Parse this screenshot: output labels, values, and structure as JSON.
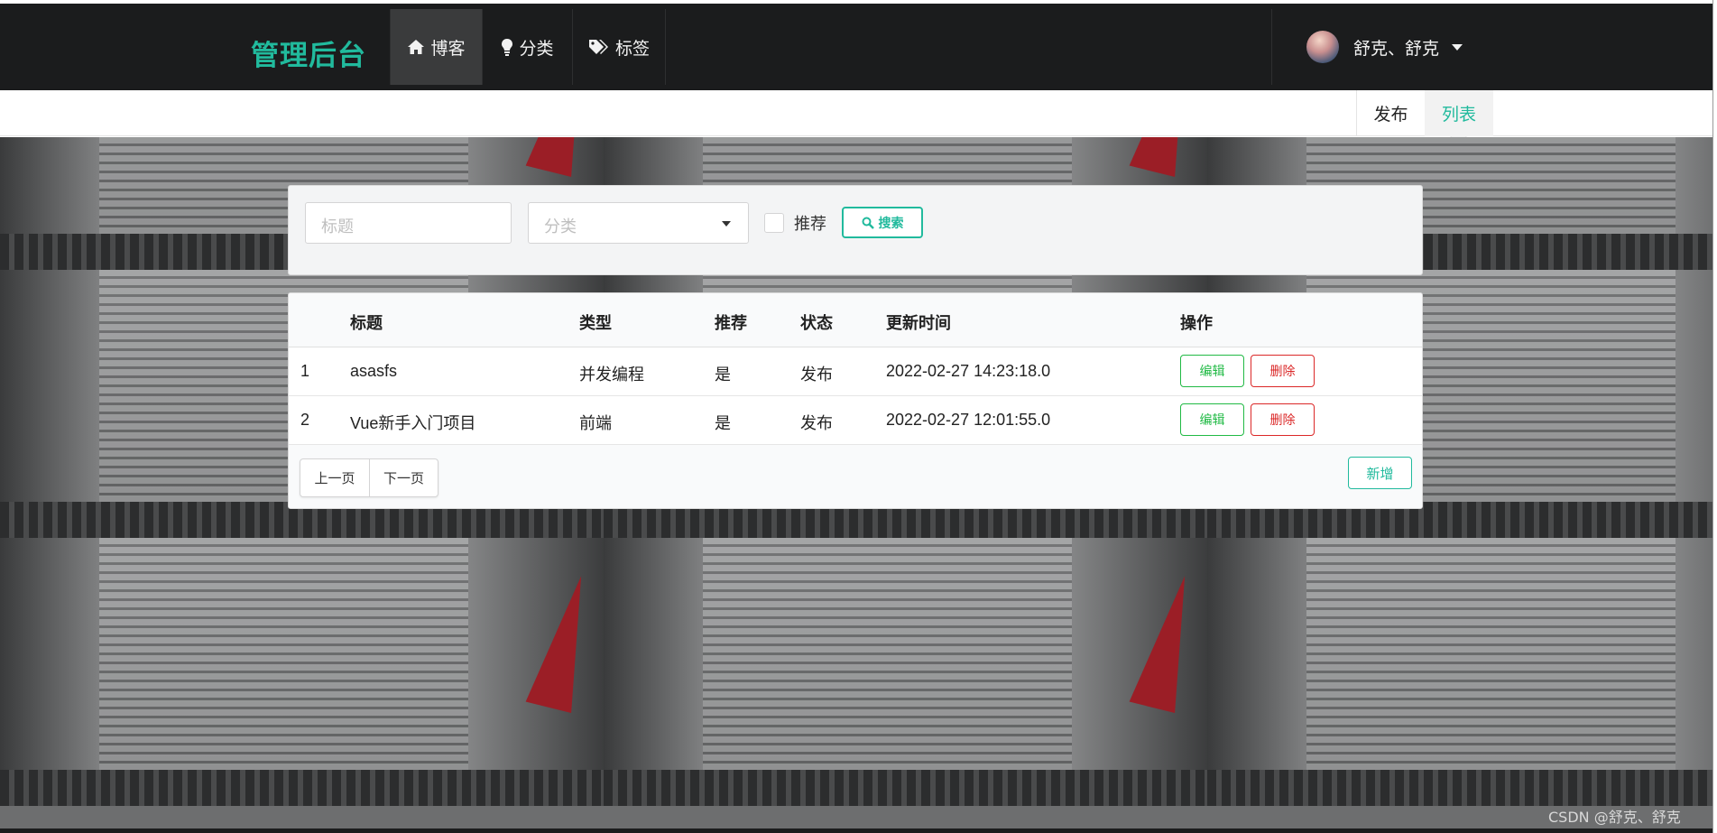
{
  "navbar": {
    "brand": "管理后台",
    "items": [
      {
        "label": "博客",
        "icon": "home-icon",
        "active": true
      },
      {
        "label": "分类",
        "icon": "lightbulb-icon",
        "active": false
      },
      {
        "label": "标签",
        "icon": "tags-icon",
        "active": false
      }
    ],
    "user": {
      "name": "舒克、舒克"
    }
  },
  "submenu": {
    "publish_label": "发布",
    "list_label": "列表"
  },
  "search": {
    "title_placeholder": "标题",
    "category_placeholder": "分类",
    "recommend_label": "推荐",
    "search_label": "搜索"
  },
  "table": {
    "headers": [
      "",
      "标题",
      "类型",
      "推荐",
      "状态",
      "更新时间",
      "操作"
    ],
    "rows": [
      {
        "index": "1",
        "title": "asasfs",
        "type": "并发编程",
        "recommend": "是",
        "status": "发布",
        "updated": "2022-02-27 14:23:18.0"
      },
      {
        "index": "2",
        "title": "Vue新手入门项目",
        "type": "前端",
        "recommend": "是",
        "status": "发布",
        "updated": "2022-02-27 12:01:55.0"
      }
    ],
    "edit_label": "编辑",
    "delete_label": "删除",
    "prev_label": "上一页",
    "next_label": "下一页",
    "add_label": "新增"
  },
  "watermark": "CSDN @舒克、舒克",
  "colors": {
    "accent": "#21ba9d",
    "navbar_bg": "#1b1c1d",
    "edit": "#21ba45",
    "delete": "#db2828"
  }
}
